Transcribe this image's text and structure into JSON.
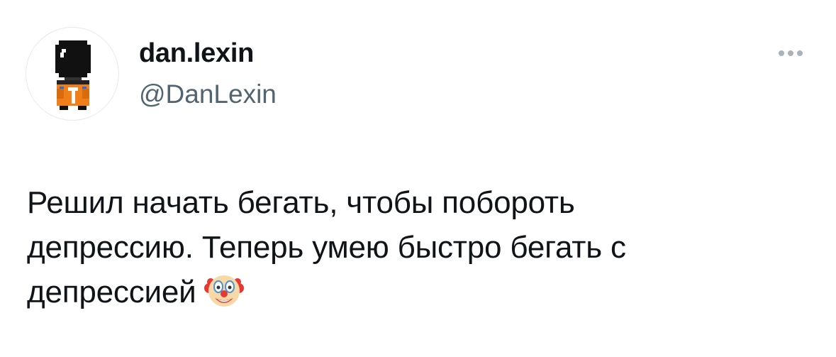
{
  "tweet": {
    "author": {
      "display_name": "dan.lexin",
      "handle": "@DanLexin",
      "avatar_icon": "pixel-astronaut-avatar"
    },
    "more_icon": "more-horizontal-icon",
    "text_lines": [
      "Решил начать бегать, чтобы побороть",
      "депрессию. Теперь умею быстро бегать с",
      "депрессией"
    ],
    "emoji": "clown-face-emoji",
    "colors": {
      "primary_text": "#0f1419",
      "secondary_text": "#536471",
      "more_dots": "#aab3ba",
      "avatar_orange": "#f07f1a"
    }
  }
}
